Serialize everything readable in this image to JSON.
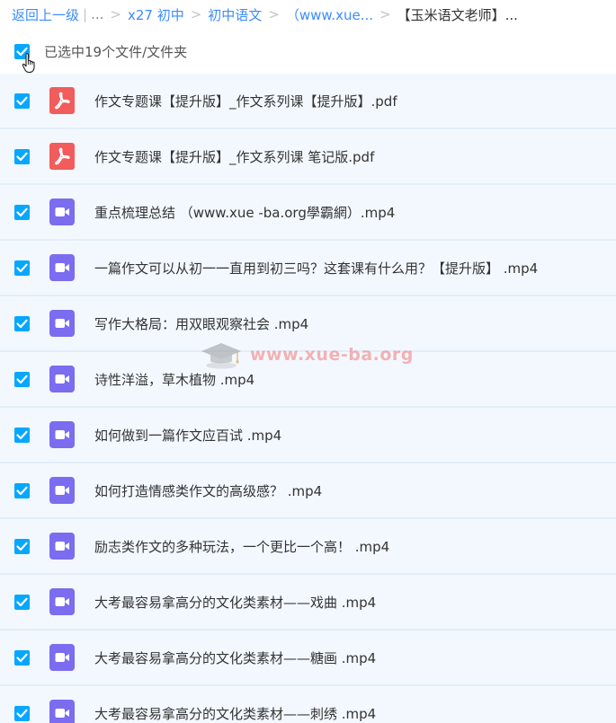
{
  "breadcrumb": {
    "back_label": "返回上一级",
    "pipe": "|",
    "ellipsis": "...",
    "sep": ">",
    "items": [
      "x27 初中",
      "初中语文",
      "（www.xue..."
    ],
    "current": "【玉米语文老师】..."
  },
  "selection": {
    "label": "已选中19个文件/文件夹"
  },
  "files": [
    {
      "name": "作文专题课【提升版】_作文系列课【提升版】.pdf",
      "type": "pdf"
    },
    {
      "name": "作文专题课【提升版】_作文系列课 笔记版.pdf",
      "type": "pdf"
    },
    {
      "name": "重点梳理总结 （www.xue -ba.org學霸網）.mp4",
      "type": "video"
    },
    {
      "name": "一篇作文可以从初一一直用到初三吗？这套课有什么用？【提升版】 .mp4",
      "type": "video"
    },
    {
      "name": "写作大格局：用双眼观察社会 .mp4",
      "type": "video"
    },
    {
      "name": "诗性洋溢，草木植物 .mp4",
      "type": "video"
    },
    {
      "name": "如何做到一篇作文应百试 .mp4",
      "type": "video"
    },
    {
      "name": "如何打造情感类作文的高级感？ .mp4",
      "type": "video"
    },
    {
      "name": "励志类作文的多种玩法，一个更比一个高！ .mp4",
      "type": "video"
    },
    {
      "name": "大考最容易拿高分的文化类素材——戏曲 .mp4",
      "type": "video"
    },
    {
      "name": "大考最容易拿高分的文化类素材——糖画 .mp4",
      "type": "video"
    },
    {
      "name": "大考最容易拿高分的文化类素材——刺绣 .mp4",
      "type": "video"
    }
  ],
  "watermark": {
    "text": "www.xue-ba.org"
  },
  "colors": {
    "link": "#3b8cff",
    "checkbox": "#06a7ff",
    "pdf_icon": "#f25c5c",
    "video_icon": "#7b6cf0",
    "row_bg": "#f3f8fe"
  }
}
